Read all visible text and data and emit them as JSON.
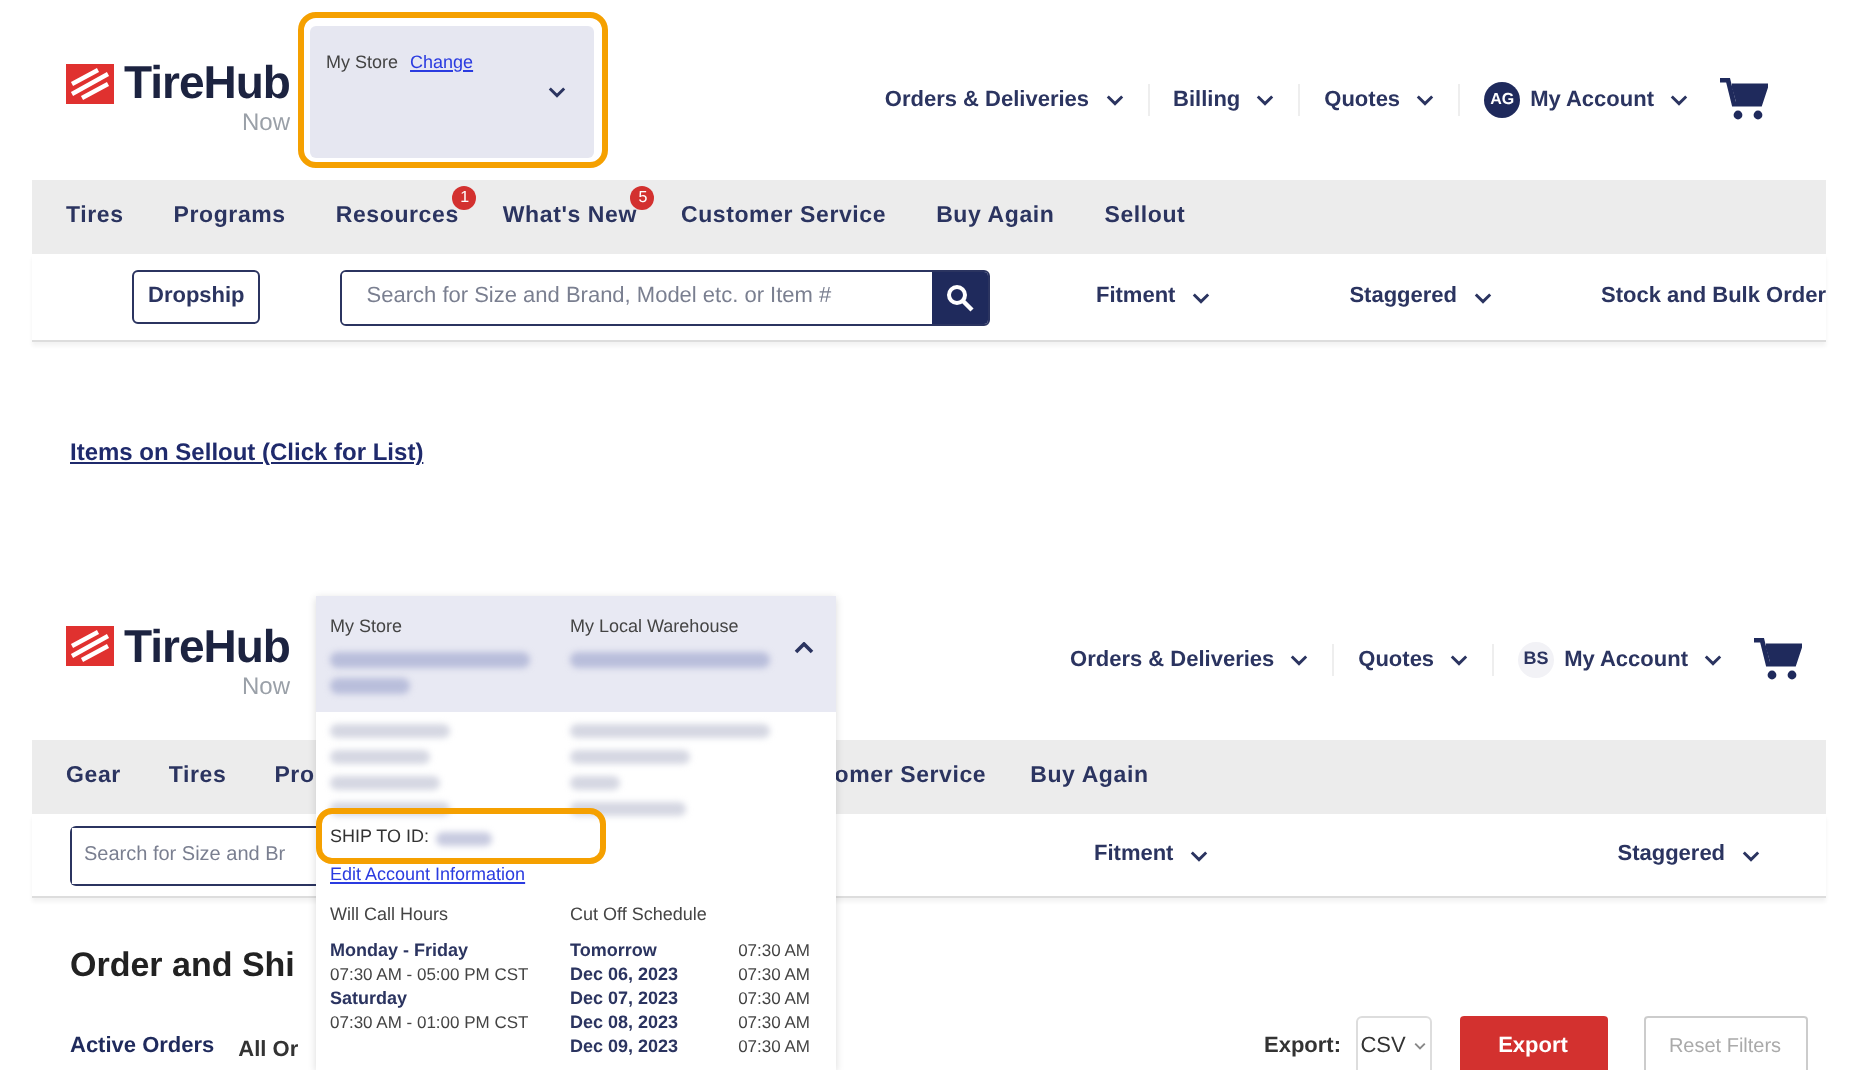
{
  "top_screenshot": {
    "logo": {
      "name": "TireHub",
      "tagline": "Now"
    },
    "store_selector": {
      "label": "My Store",
      "link": "Change",
      "highlighted": true
    },
    "header_menu": [
      {
        "label": "Orders & Deliveries"
      },
      {
        "label": "Billing"
      },
      {
        "label": "Quotes"
      }
    ],
    "account": {
      "initials": "AG",
      "filled": true,
      "label": "My Account"
    },
    "nav": [
      {
        "label": "Tires"
      },
      {
        "label": "Programs"
      },
      {
        "label": "Resources",
        "badge": "1"
      },
      {
        "label": "What's New",
        "badge": "5"
      },
      {
        "label": "Customer Service"
      },
      {
        "label": "Buy Again"
      },
      {
        "label": "Sellout"
      }
    ],
    "dropship": "Dropship",
    "search": {
      "placeholder": "Search for Size and Brand, Model etc. or Item #"
    },
    "filters": [
      {
        "label": "Fitment",
        "kind": "dropdown"
      },
      {
        "label": "Staggered",
        "kind": "dropdown"
      },
      {
        "label": "Stock and Bulk Order",
        "kind": "link"
      }
    ],
    "sellout_link": "Items on Sellout (Click for List)"
  },
  "bottom_screenshot": {
    "logo": {
      "name": "TireHub",
      "tagline": "Now"
    },
    "header_menu": [
      {
        "label": "Orders & Deliveries"
      },
      {
        "label": "Quotes"
      }
    ],
    "account": {
      "initials": "BS",
      "filled": false,
      "label": "My Account"
    },
    "nav": [
      {
        "label": "Gear"
      },
      {
        "label": "Tires"
      },
      {
        "label": "Pro"
      },
      {
        "label": "omer Service"
      },
      {
        "label": "Buy Again"
      }
    ],
    "search": {
      "placeholder": "Search for Size and Br"
    },
    "filters": [
      {
        "label": "Fitment",
        "kind": "dropdown"
      },
      {
        "label": "Staggered",
        "kind": "dropdown"
      }
    ],
    "heading": "Order and Shi",
    "tabs": [
      {
        "label": "Active Orders",
        "selected": true
      },
      {
        "label": "All Or",
        "selected": false
      }
    ],
    "export": {
      "label": "Export:",
      "format": "CSV",
      "button": "Export"
    },
    "reset": {
      "label": "Reset Filters",
      "disabled": true
    },
    "store_panel": {
      "expanded": true,
      "columns": [
        {
          "heading": "My Store"
        },
        {
          "heading": "My Local Warehouse"
        }
      ],
      "ship_to": {
        "label": "SHIP TO ID:",
        "highlighted": true
      },
      "edit_link": "Edit Account Information",
      "hours": {
        "heading": "Will Call Hours",
        "entries": [
          {
            "days": "Monday - Friday",
            "time": "07:30 AM - 05:00 PM CST"
          },
          {
            "days": "Saturday",
            "time": "07:30 AM - 01:00 PM CST"
          }
        ]
      },
      "cutoff": {
        "heading": "Cut Off Schedule",
        "rows": [
          {
            "day": "Tomorrow",
            "time": "07:30 AM"
          },
          {
            "day": "Dec 06, 2023",
            "time": "07:30 AM"
          },
          {
            "day": "Dec 07, 2023",
            "time": "07:30 AM"
          },
          {
            "day": "Dec 08, 2023",
            "time": "07:30 AM"
          },
          {
            "day": "Dec 09, 2023",
            "time": "07:30 AM"
          }
        ]
      }
    }
  }
}
